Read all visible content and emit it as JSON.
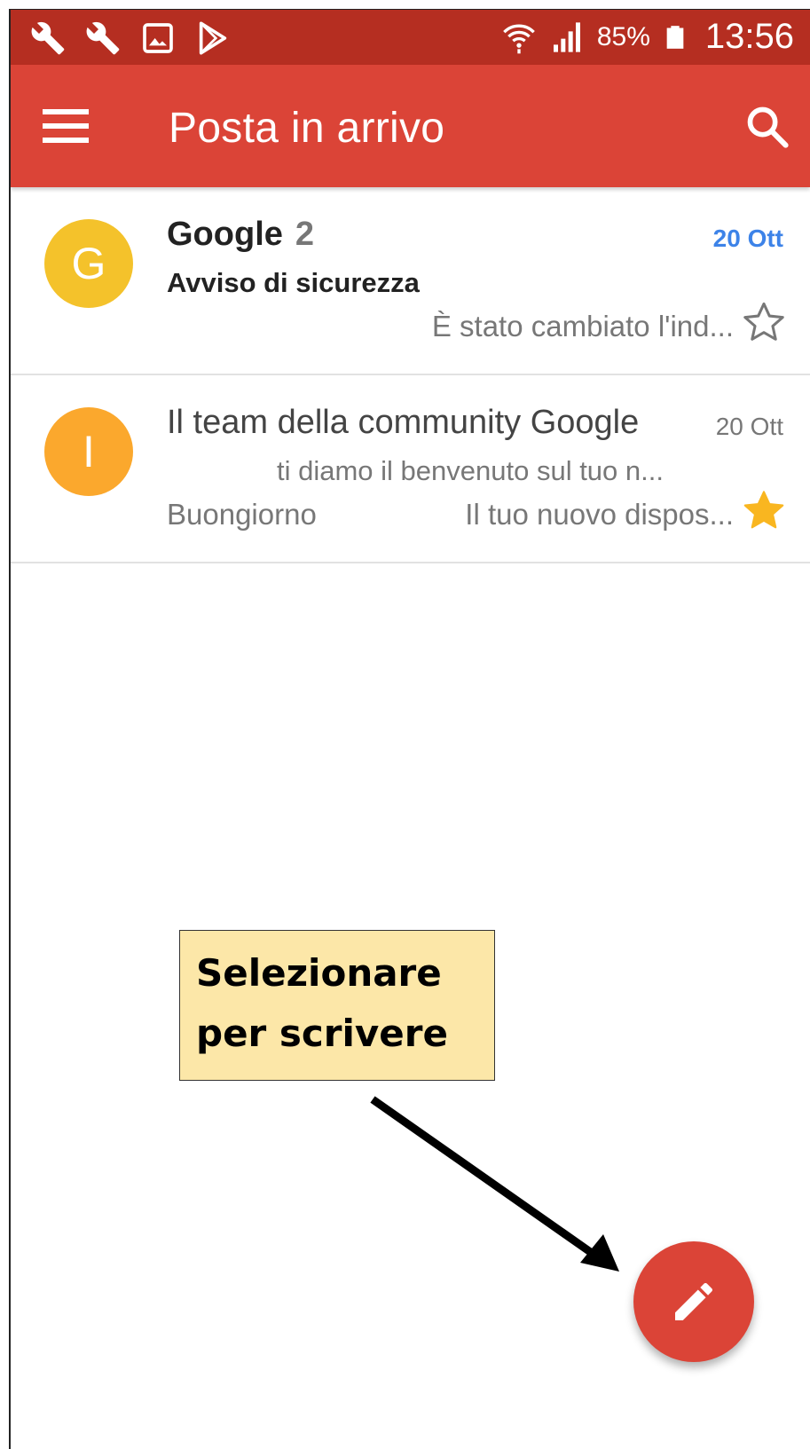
{
  "status_bar": {
    "left_icons": [
      "wrench-icon",
      "wrench-icon",
      "image-icon",
      "play-store-icon"
    ],
    "battery_percent": "85%",
    "time": "13:56"
  },
  "app_bar": {
    "title": "Posta in arrivo",
    "menu_icon": "menu-icon",
    "search_icon": "search-icon",
    "color": "#db4437"
  },
  "emails": [
    {
      "avatar_letter": "G",
      "avatar_color": "#f4c22b",
      "sender": "Google",
      "count": "2",
      "date": "20 Ott",
      "subject": "Avviso di sicurezza",
      "snippet": "È stato cambiato l'ind...",
      "starred": false,
      "unread": true
    },
    {
      "avatar_letter": "I",
      "avatar_color": "#fba82d",
      "sender": "Il team della community Google",
      "date": "20 Ott",
      "subject": "ti diamo il benvenuto sul tuo n...",
      "label": "Buongiorno",
      "snippet": "Il tuo nuovo dispos...",
      "starred": true,
      "unread": false
    }
  ],
  "callout": {
    "line1": "Selezionare",
    "line2": "per scrivere"
  },
  "fab": {
    "icon": "pencil-icon",
    "color": "#db4437"
  }
}
